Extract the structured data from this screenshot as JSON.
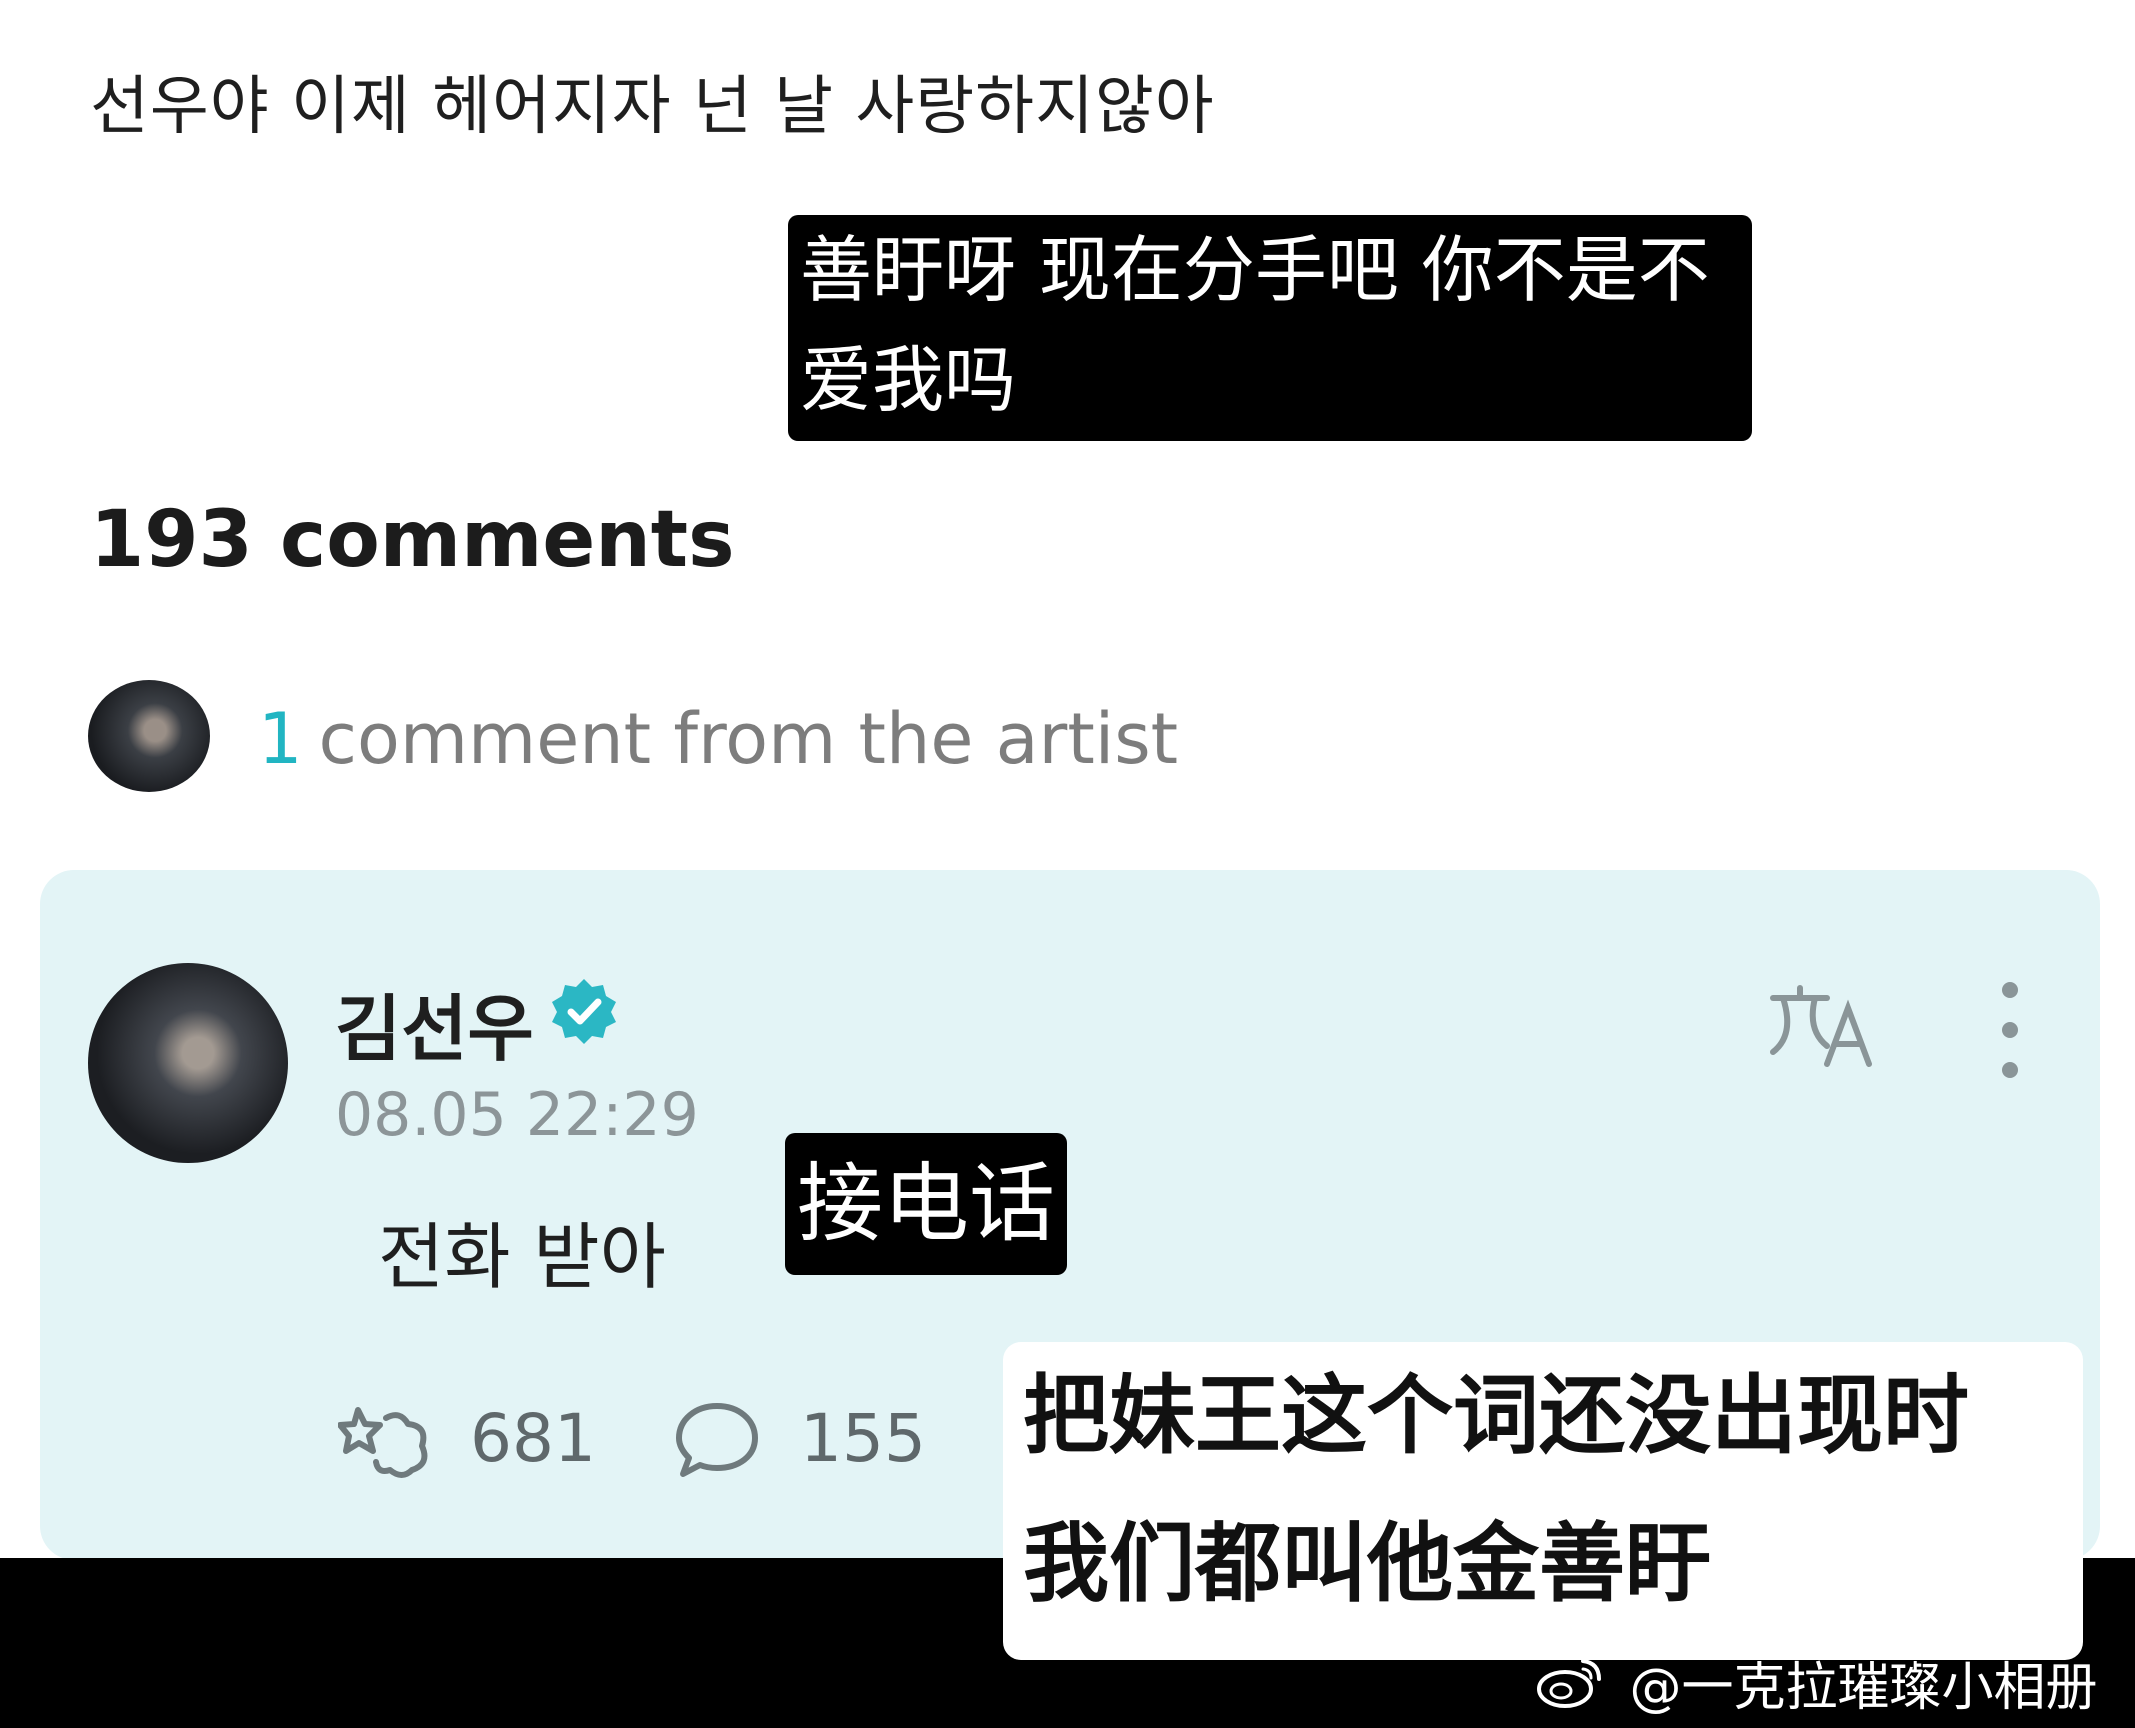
{
  "post": {
    "text": "선우야 이제 헤어지자 넌 날 사랑하지않아"
  },
  "subtitles": {
    "top": "善盱呀 现在分手吧 你不是不爱我吗",
    "comment": "接电话",
    "bottom": "把妹王这个词还没出现时 我们都叫他金善盱"
  },
  "comments_header": {
    "count_label": "193 comments"
  },
  "artist_summary": {
    "count": "1",
    "label": "comment from the artist"
  },
  "artist_comment": {
    "username": "김선우",
    "timestamp": "08.05 22:29",
    "text": "전화 받아",
    "likes": "681",
    "replies": "155"
  },
  "icons": {
    "verified": "verified-badge-icon",
    "translate": "translate-icon",
    "more": "more-vertical-icon",
    "like": "like-icon",
    "reply": "reply-icon",
    "weibo": "weibo-logo-icon"
  },
  "colors": {
    "accent": "#21b5c2",
    "card_background": "#e3f4f6",
    "subtitle_black": "#000000"
  },
  "watermark": {
    "text": "@一克拉璀璨小相册"
  }
}
